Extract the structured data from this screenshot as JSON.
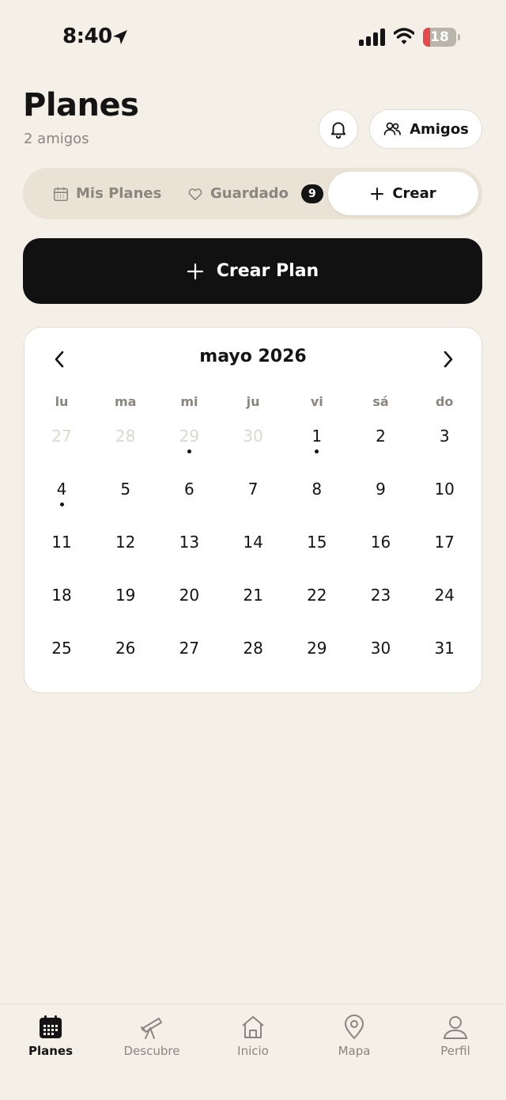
{
  "status_bar": {
    "time": "8:40",
    "battery": "18"
  },
  "header": {
    "title": "Planes",
    "subtitle": "2 amigos",
    "friends_button": "Amigos"
  },
  "segmented": {
    "mis_planes": "Mis Planes",
    "guardado": "Guardado",
    "guardado_count": "9",
    "crear": "Crear"
  },
  "create_plan_label": "Crear Plan",
  "calendar": {
    "month_label": "mayo 2026",
    "weekdays": [
      "lu",
      "ma",
      "mi",
      "ju",
      "vi",
      "sá",
      "do"
    ],
    "days": [
      {
        "n": "27",
        "muted": true
      },
      {
        "n": "28",
        "muted": true
      },
      {
        "n": "29",
        "muted": true,
        "dot": true
      },
      {
        "n": "30",
        "muted": true
      },
      {
        "n": "1",
        "dot": true
      },
      {
        "n": "2"
      },
      {
        "n": "3"
      },
      {
        "n": "4",
        "dot": true
      },
      {
        "n": "5"
      },
      {
        "n": "6"
      },
      {
        "n": "7"
      },
      {
        "n": "8"
      },
      {
        "n": "9"
      },
      {
        "n": "10"
      },
      {
        "n": "11"
      },
      {
        "n": "12"
      },
      {
        "n": "13"
      },
      {
        "n": "14"
      },
      {
        "n": "15"
      },
      {
        "n": "16"
      },
      {
        "n": "17"
      },
      {
        "n": "18"
      },
      {
        "n": "19"
      },
      {
        "n": "20"
      },
      {
        "n": "21"
      },
      {
        "n": "22"
      },
      {
        "n": "23"
      },
      {
        "n": "24"
      },
      {
        "n": "25"
      },
      {
        "n": "26"
      },
      {
        "n": "27"
      },
      {
        "n": "28"
      },
      {
        "n": "29"
      },
      {
        "n": "30"
      },
      {
        "n": "31"
      }
    ]
  },
  "tab_bar": {
    "planes": "Planes",
    "descubre": "Descubre",
    "inicio": "Inicio",
    "mapa": "Mapa",
    "perfil": "Perfil"
  },
  "colors": {
    "background": "#F4EFE7",
    "primary": "#111111",
    "muted_text": "#8A857E",
    "battery_low": "#E5484D"
  }
}
